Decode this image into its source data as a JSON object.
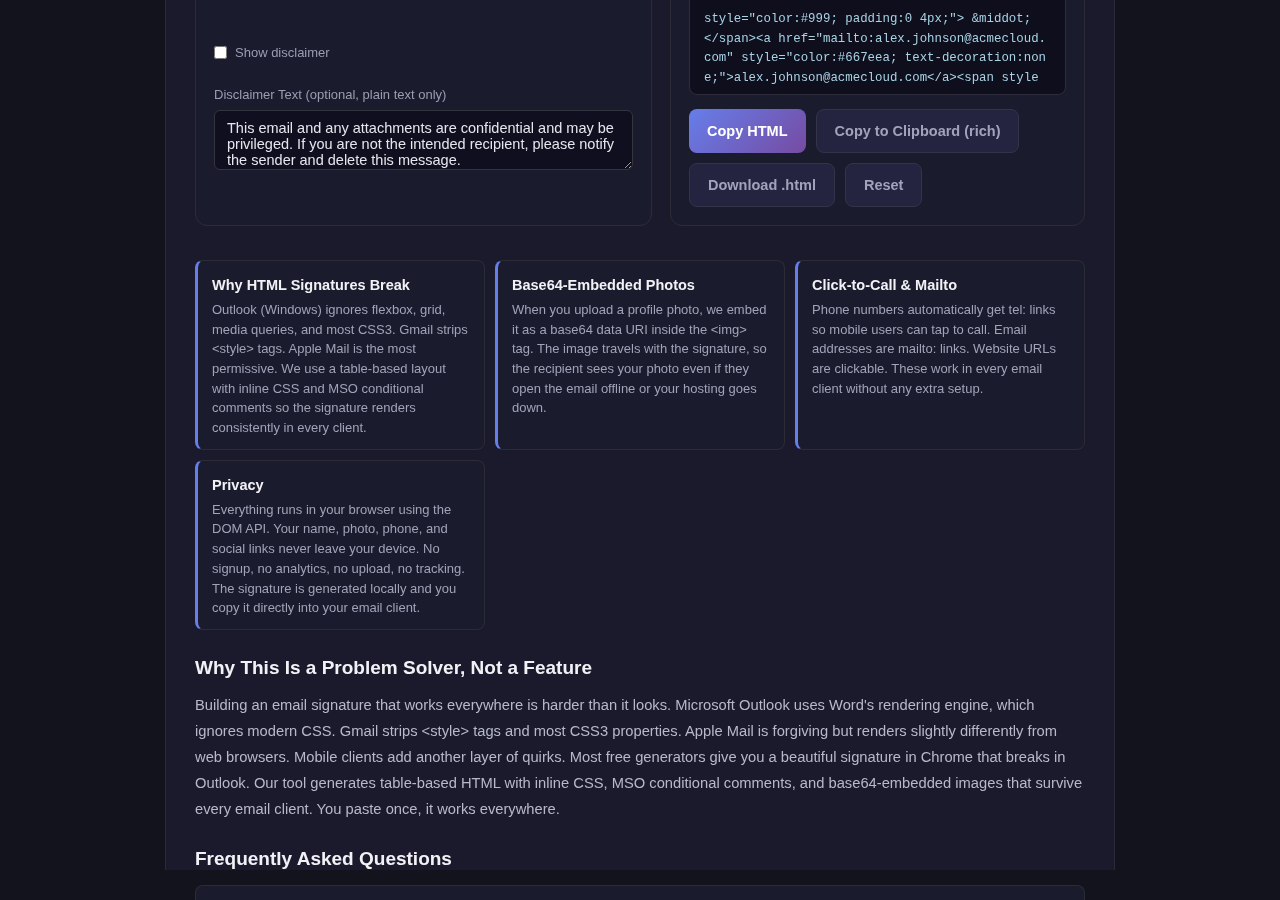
{
  "disclaimer_panel": {
    "show_disclaimer": {
      "label": "Show disclaimer",
      "checked": false
    },
    "disclaimer_text": {
      "label": "Disclaimer Text (optional, plain text only)",
      "value": "This email and any attachments are confidential and may be privileged. If you are not the intended recipient, please notify the sender and delete this message."
    }
  },
  "output_panel": {
    "code_lines": [
      "style=\"color:#999; padding:0 4px;\"> &middot;",
      "</span><a href=\"mailto:alex.johnson@acmecloud.",
      "com\" style=\"color:#667eea; text-decoration:non",
      "e;\">alex.johnson@acmecloud.com</a><span style"
    ],
    "buttons": [
      {
        "label": "Copy HTML",
        "kind": "primary"
      },
      {
        "label": "Copy to Clipboard (rich)",
        "kind": "secondary"
      },
      {
        "label": "Download .html",
        "kind": "secondary"
      },
      {
        "label": "Reset",
        "kind": "secondary"
      }
    ]
  },
  "info_cards": [
    {
      "title": "Why HTML Signatures Break",
      "body": "Outlook (Windows) ignores flexbox, grid, media queries, and most CSS3. Gmail strips <style> tags. Apple Mail is the most permissive. We use a table-based layout with inline CSS and MSO conditional comments so the signature renders consistently in every client."
    },
    {
      "title": "Base64-Embedded Photos",
      "body": "When you upload a profile photo, we embed it as a base64 data URI inside the <img> tag. The image travels with the signature, so the recipient sees your photo even if they open the email offline or your hosting goes down."
    },
    {
      "title": "Click-to-Call & Mailto",
      "body": "Phone numbers automatically get tel: links so mobile users can tap to call. Email addresses are mailto: links. Website URLs are clickable. These work in every email client without any extra setup."
    },
    {
      "title": "Privacy",
      "body": "Everything runs in your browser using the DOM API. Your name, photo, phone, and social links never leave your device. No signup, no analytics, no upload, no tracking. The signature is generated locally and you copy it directly into your email client."
    }
  ],
  "problem_section": {
    "heading": "Why This Is a Problem Solver, Not a Feature",
    "paragraph": "Building an email signature that works everywhere is harder than it looks. Microsoft Outlook uses Word's rendering engine, which ignores modern CSS. Gmail strips <style> tags and most CSS3 properties. Apple Mail is forgiving but renders slightly differently from web browsers. Mobile clients add another layer of quirks. Most free generators give you a beautiful signature in Chrome that breaks in Outlook. Our tool generates table-based HTML with inline CSS, MSO conditional comments, and base64-embedded images that survive every email client. You paste once, it works everywhere."
  },
  "faq": {
    "heading": "Frequently Asked Questions"
  }
}
